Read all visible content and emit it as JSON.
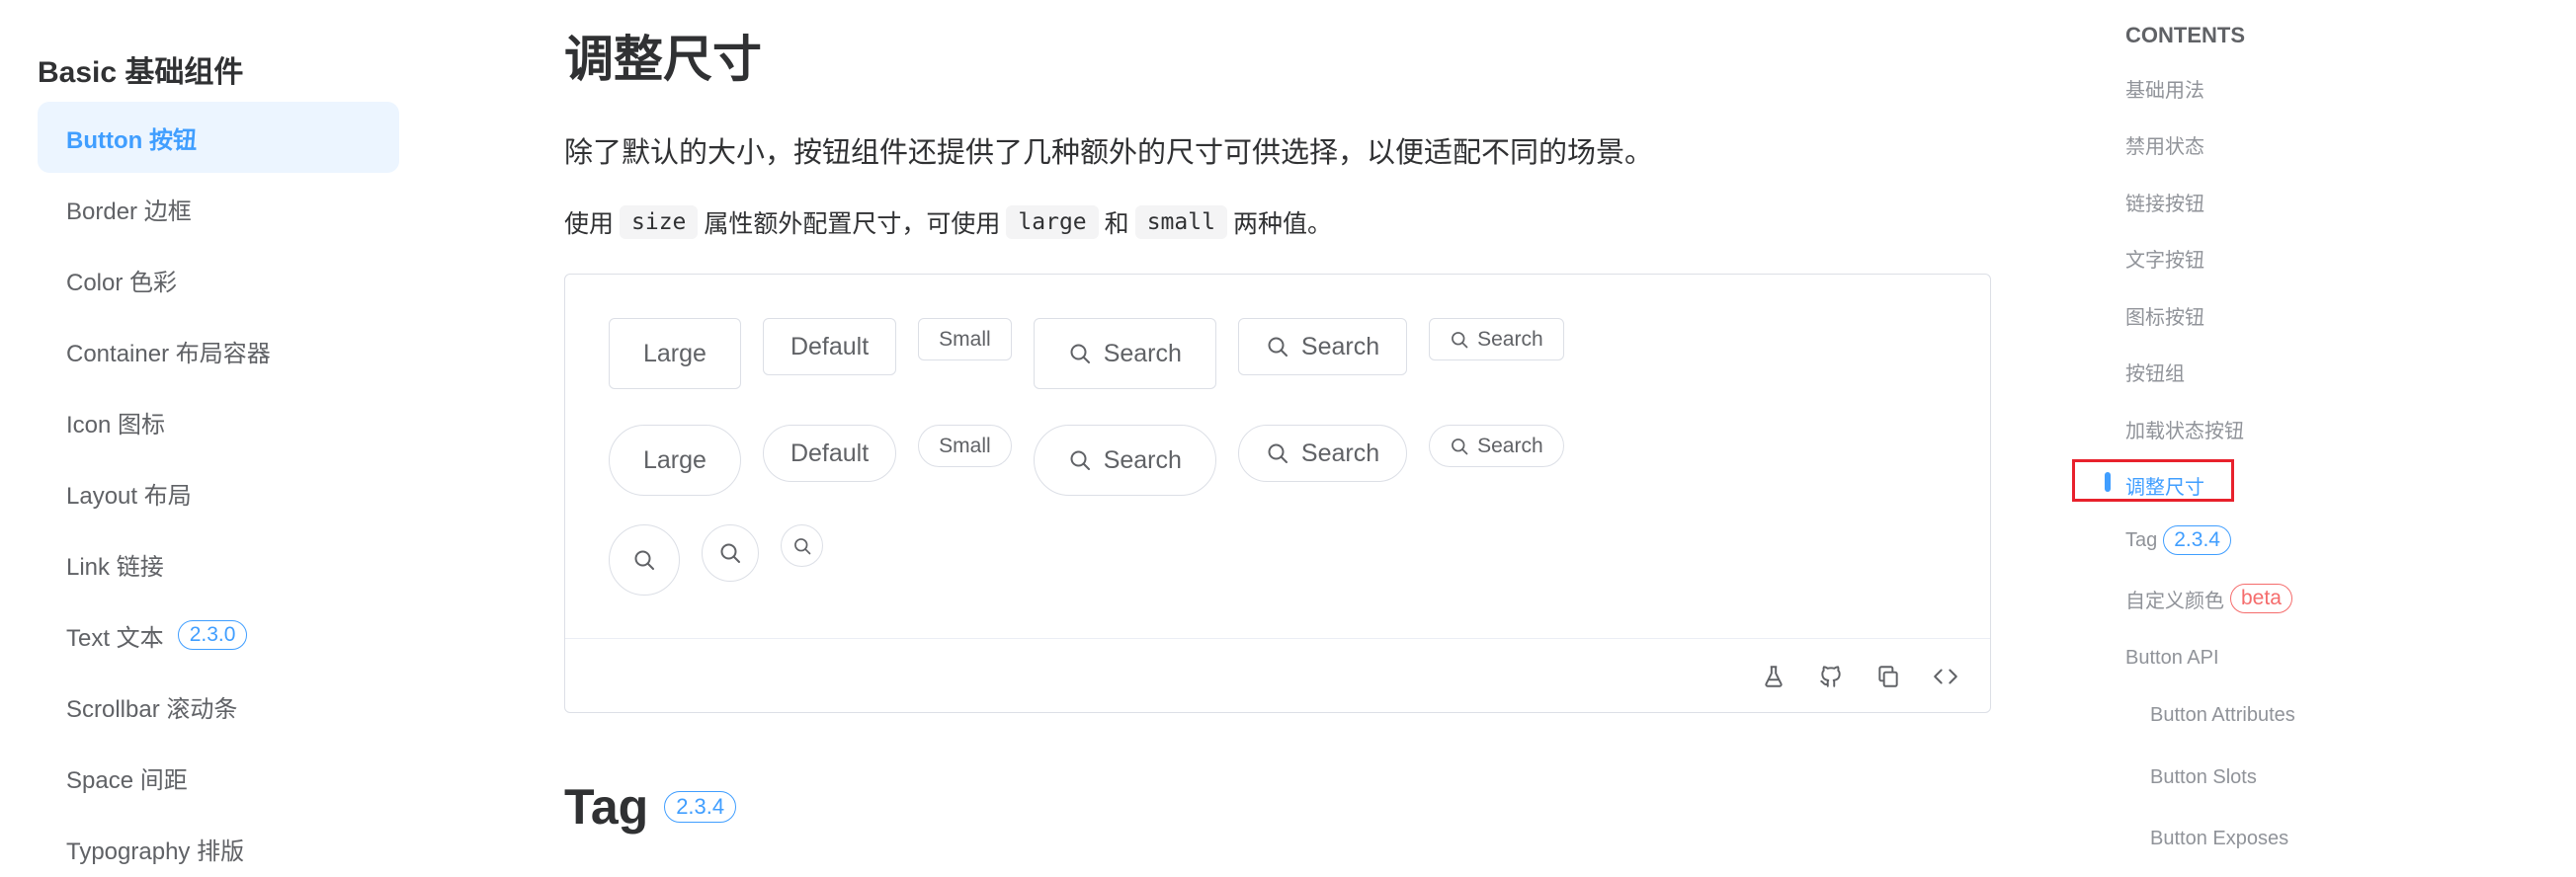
{
  "sidebar": {
    "group_title": "Basic 基础组件",
    "items": [
      {
        "label": "Button 按钮",
        "active": true
      },
      {
        "label": "Border 边框"
      },
      {
        "label": "Color 色彩"
      },
      {
        "label": "Container 布局容器"
      },
      {
        "label": "Icon 图标"
      },
      {
        "label": "Layout 布局"
      },
      {
        "label": "Link 链接"
      },
      {
        "label": "Text 文本",
        "badge": "2.3.0"
      },
      {
        "label": "Scrollbar 滚动条"
      },
      {
        "label": "Space 间距"
      },
      {
        "label": "Typography 排版"
      }
    ]
  },
  "main": {
    "section_title": "调整尺寸",
    "intro": "除了默认的大小，按钮组件还提供了几种额外的尺寸可供选择，以便适配不同的场景。",
    "usage": {
      "prefix": "使用",
      "code1": "size",
      "middle": "属性额外配置尺寸，可使用",
      "code2": "large",
      "and": "和",
      "code3": "small",
      "suffix": "两种值。"
    },
    "demo": {
      "large_label": "Large",
      "default_label": "Default",
      "small_label": "Small",
      "search_label": "Search"
    },
    "next_section_title": "Tag",
    "next_section_badge": "2.3.4"
  },
  "toc": {
    "title": "CONTENTS",
    "items": [
      {
        "label": "基础用法"
      },
      {
        "label": "禁用状态"
      },
      {
        "label": "链接按钮"
      },
      {
        "label": "文字按钮"
      },
      {
        "label": "图标按钮"
      },
      {
        "label": "按钮组"
      },
      {
        "label": "加载状态按钮"
      },
      {
        "label": "调整尺寸",
        "active": true
      },
      {
        "label": "Tag",
        "badge": "2.3.4"
      },
      {
        "label": "自定义颜色",
        "badge": "beta"
      },
      {
        "label": "Button API"
      },
      {
        "label": "Button Attributes"
      },
      {
        "label": "Button Slots"
      },
      {
        "label": "Button Exposes"
      }
    ]
  },
  "colors": {
    "primary": "#409eff",
    "active_bg": "#ecf5ff",
    "beta": "#f56c6c",
    "highlight": "#e8212c"
  }
}
